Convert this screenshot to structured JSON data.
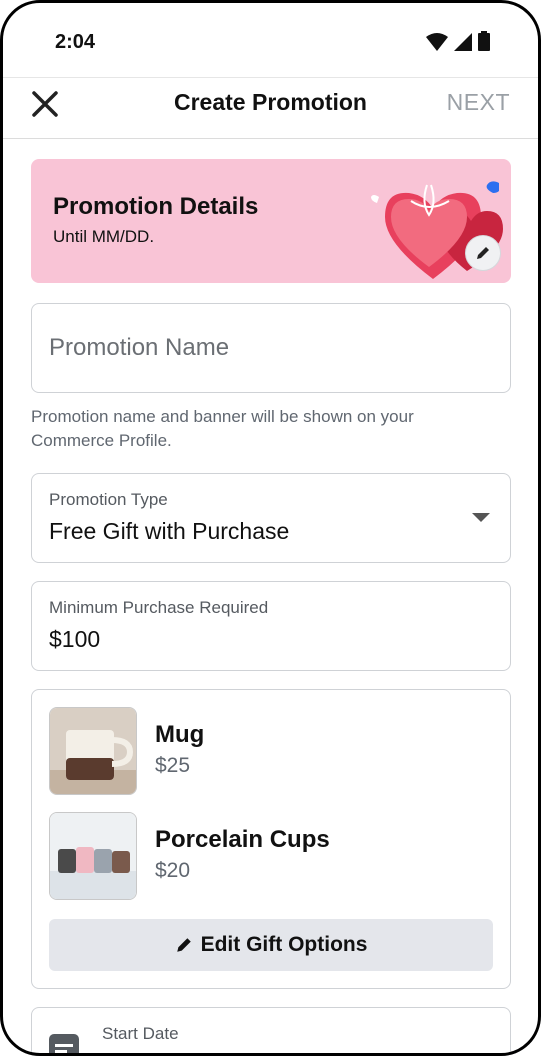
{
  "status_bar": {
    "time": "2:04",
    "icons": [
      "wifi-icon",
      "signal-icon",
      "battery-icon"
    ]
  },
  "app_bar": {
    "title": "Create Promotion",
    "next_label": "NEXT",
    "close_icon": "close-icon"
  },
  "banner": {
    "title": "Promotion Details",
    "subtitle": "Until MM/DD.",
    "background": "#f9c4d6",
    "edit_icon": "pencil-icon"
  },
  "form": {
    "promotion_name": {
      "placeholder": "Promotion Name",
      "value": ""
    },
    "helper_text": "Promotion name and banner will be shown on your Commerce Profile.",
    "promotion_type": {
      "label": "Promotion Type",
      "value": "Free Gift with Purchase"
    },
    "minimum_purchase": {
      "label": "Minimum Purchase Required",
      "value": "$100"
    },
    "start_date": {
      "label": "Start Date"
    }
  },
  "gift_options": {
    "items": [
      {
        "name": "Mug",
        "price": "$25"
      },
      {
        "name": "Porcelain Cups",
        "price": "$20"
      }
    ],
    "edit_button_label": "Edit Gift Options"
  }
}
